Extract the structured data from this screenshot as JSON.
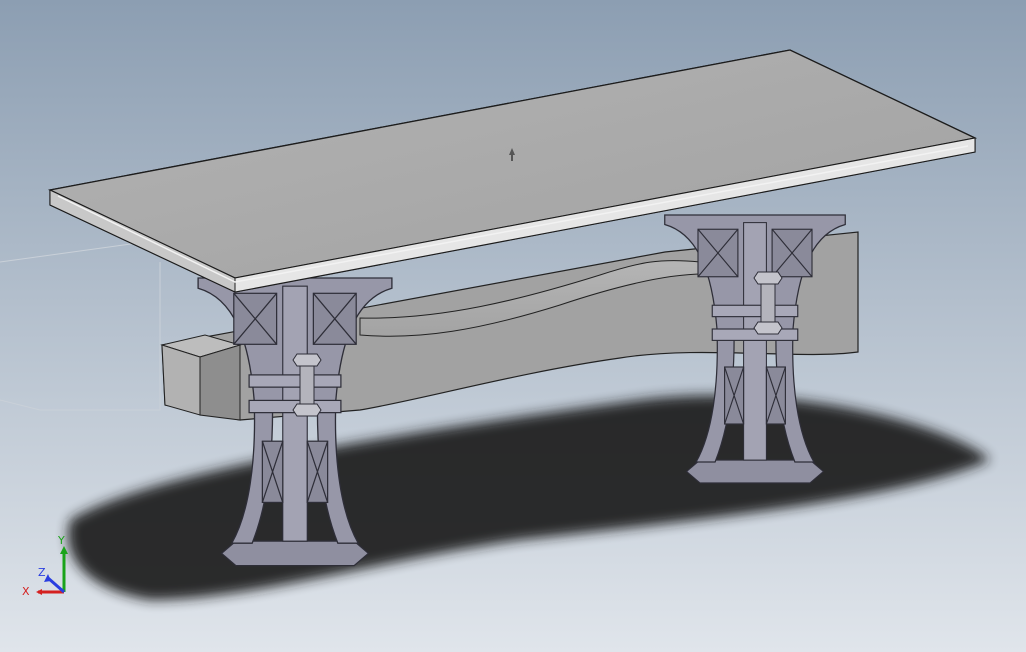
{
  "app": {
    "type": "cad-3d-viewport",
    "background": {
      "top": "#8d9fb3",
      "bottom": "#dfe4ea"
    }
  },
  "model": {
    "shading_color": "#a5a5a5",
    "leg_color": "#9595a6",
    "shadow_color": "#1a1a1a",
    "parts": [
      "table-top",
      "beam",
      "left-leg",
      "right-leg",
      "left-bolt-assembly",
      "right-bolt-assembly"
    ]
  },
  "triad": {
    "x_label": "X",
    "y_label": "Y",
    "z_label": "Z",
    "x_color": "#d42020",
    "y_color": "#1aa31a",
    "z_color": "#2a3ee0"
  },
  "origin_marker": {
    "icon": "origin-arrow-icon"
  }
}
